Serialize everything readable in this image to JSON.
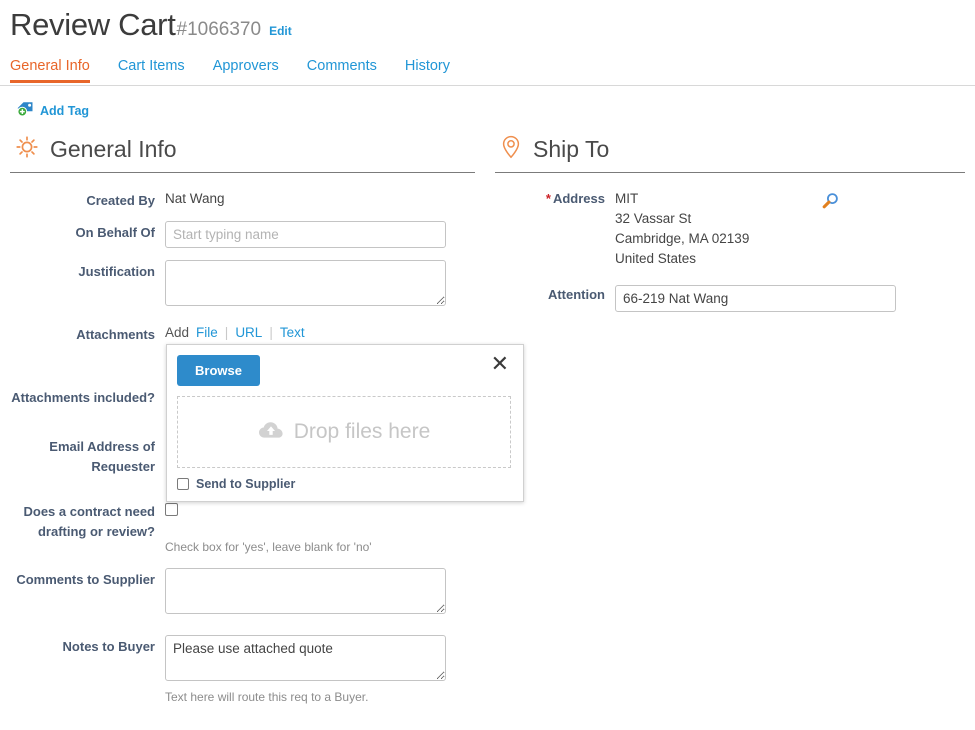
{
  "header": {
    "title": "Review Cart",
    "req_id": "#1066370",
    "edit_label": "Edit"
  },
  "tabs": [
    {
      "label": "General Info",
      "active": true
    },
    {
      "label": "Cart Items",
      "active": false
    },
    {
      "label": "Approvers",
      "active": false
    },
    {
      "label": "Comments",
      "active": false
    },
    {
      "label": "History",
      "active": false
    }
  ],
  "add_tag": {
    "label": "Add Tag",
    "icon": "tag-plus-icon"
  },
  "general_info": {
    "section_title": "General Info",
    "section_icon": "gear-icon",
    "created_by": {
      "label": "Created By",
      "value": "Nat Wang"
    },
    "on_behalf_of": {
      "label": "On Behalf Of",
      "value": "",
      "placeholder": "Start typing name"
    },
    "justification": {
      "label": "Justification",
      "value": ""
    },
    "attachments": {
      "label": "Attachments",
      "add_text": "Add",
      "links": [
        "File",
        "URL",
        "Text"
      ]
    },
    "attachments_included": {
      "label": "Attachments included?"
    },
    "email_address_of_requester": {
      "label": "Email Address of Requester"
    },
    "contract_needed": {
      "label": "Does a contract need drafting or review?",
      "checked": false,
      "hint": "Check box for 'yes', leave blank for 'no'"
    },
    "comments_to_supplier": {
      "label": "Comments to Supplier",
      "value": ""
    },
    "notes_to_buyer": {
      "label": "Notes to Buyer",
      "value": "Please use attached quote",
      "hint": "Text here will route this req to a Buyer."
    }
  },
  "ship_to": {
    "section_title": "Ship To",
    "section_icon": "map-pin-icon",
    "address": {
      "label": "Address",
      "required": true,
      "lines": [
        "MIT",
        "32 Vassar St",
        "Cambridge, MA 02139",
        "United States"
      ],
      "search_icon": "magnifier-icon"
    },
    "attention": {
      "label": "Attention",
      "value": "66-219 Nat Wang"
    }
  },
  "upload_panel": {
    "browse_label": "Browse",
    "close_label": "✕",
    "drop_text": "Drop files here",
    "drop_icon": "cloud-upload-icon",
    "send_to_supplier": {
      "label": "Send to Supplier",
      "checked": false
    }
  },
  "colors": {
    "accent_orange": "#e8662a",
    "link_blue": "#2196d6",
    "button_blue": "#2e8bcb",
    "label_slate": "#4a5a72",
    "required_red": "#cc2127"
  }
}
